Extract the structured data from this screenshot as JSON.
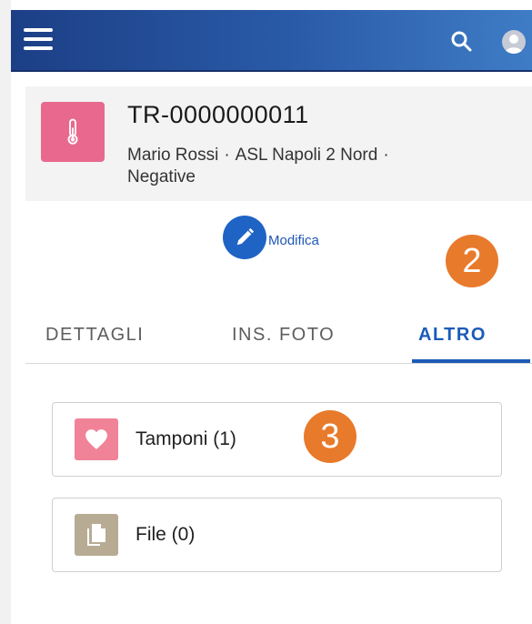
{
  "header": {
    "menu_icon": "hamburger-menu-icon",
    "search_icon": "search-icon",
    "avatar_icon": "user-avatar-icon",
    "color": "#2a5ba8"
  },
  "record": {
    "icon": "thermometer-icon",
    "icon_color": "#e8698d",
    "title": "TR-0000000011",
    "patient": "Mario Rossi",
    "asl": "ASL Napoli 2 Nord",
    "result": "Negative",
    "separator": "·"
  },
  "actions": {
    "edit_label": "Modifica",
    "edit_icon": "pencil-icon"
  },
  "annotations": {
    "badge_2": "2",
    "badge_3": "3",
    "color": "#e87a2c"
  },
  "tabs": [
    {
      "label": "DETTAGLI",
      "active": false
    },
    {
      "label": "INS. FOTO",
      "active": false
    },
    {
      "label": "ALTRO",
      "active": true
    }
  ],
  "related": [
    {
      "label": "Tamponi (1)",
      "icon": "heart-icon",
      "color": "#f08397"
    },
    {
      "label": "File (0)",
      "icon": "file-icon",
      "color": "#b7ab94"
    }
  ]
}
